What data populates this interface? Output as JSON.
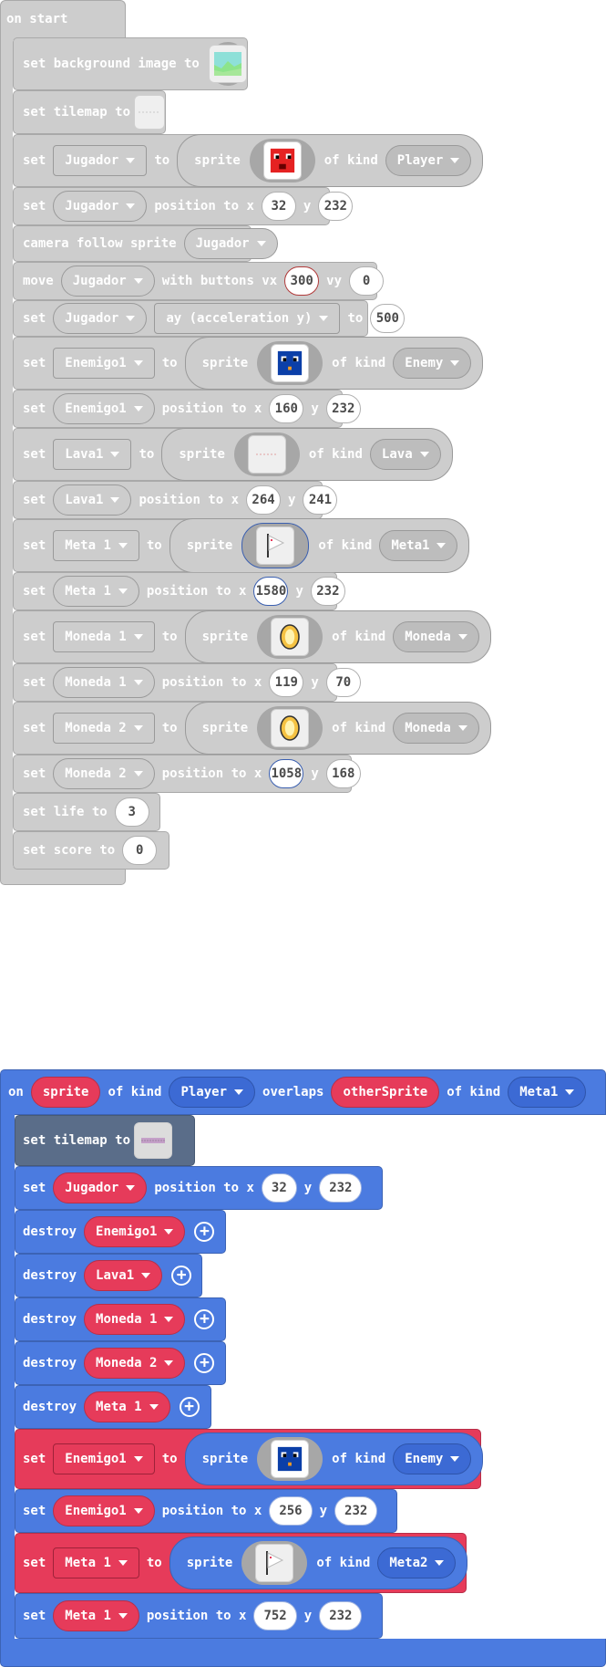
{
  "event1": {
    "label": "on start",
    "rows": {
      "bg": {
        "label": "set background image to"
      },
      "tilemap": {
        "label": "set tilemap to"
      },
      "jugador_sprite": {
        "set": "set",
        "var": "Jugador",
        "to": "to",
        "sprite": "sprite",
        "of_kind": "of kind",
        "kind": "Player"
      },
      "jugador_pos": {
        "set": "set",
        "var": "Jugador",
        "pos": "position to x",
        "x": "32",
        "y_label": "y",
        "y": "232"
      },
      "camera": {
        "label": "camera follow sprite",
        "var": "Jugador"
      },
      "move": {
        "label": "move",
        "var": "Jugador",
        "with": "with buttons vx",
        "vx": "300",
        "vy_label": "vy",
        "vy": "0"
      },
      "accel": {
        "set": "set",
        "var": "Jugador",
        "prop": "ay (acceleration y)",
        "to": "to",
        "value": "500"
      },
      "enemigo_sprite": {
        "set": "set",
        "var": "Enemigo1",
        "to": "to",
        "sprite": "sprite",
        "of_kind": "of kind",
        "kind": "Enemy"
      },
      "enemigo_pos": {
        "set": "set",
        "var": "Enemigo1",
        "pos": "position to x",
        "x": "160",
        "y_label": "y",
        "y": "232"
      },
      "lava_sprite": {
        "set": "set",
        "var": "Lava1",
        "to": "to",
        "sprite": "sprite",
        "of_kind": "of kind",
        "kind": "Lava"
      },
      "lava_pos": {
        "set": "set",
        "var": "Lava1",
        "pos": "position to x",
        "x": "264",
        "y_label": "y",
        "y": "241"
      },
      "meta_sprite": {
        "set": "set",
        "var": "Meta 1",
        "to": "to",
        "sprite": "sprite",
        "of_kind": "of kind",
        "kind": "Meta1"
      },
      "meta_pos": {
        "set": "set",
        "var": "Meta 1",
        "pos": "position to x",
        "x": "1580",
        "y_label": "y",
        "y": "232"
      },
      "moneda1_sprite": {
        "set": "set",
        "var": "Moneda 1",
        "to": "to",
        "sprite": "sprite",
        "of_kind": "of kind",
        "kind": "Moneda"
      },
      "moneda1_pos": {
        "set": "set",
        "var": "Moneda 1",
        "pos": "position to x",
        "x": "119",
        "y_label": "y",
        "y": "70"
      },
      "moneda2_sprite": {
        "set": "set",
        "var": "Moneda 2",
        "to": "to",
        "sprite": "sprite",
        "of_kind": "of kind",
        "kind": "Moneda"
      },
      "moneda2_pos": {
        "set": "set",
        "var": "Moneda 2",
        "pos": "position to x",
        "x": "1058",
        "y_label": "y",
        "y": "168"
      },
      "life": {
        "label": "set life to",
        "value": "3"
      },
      "score": {
        "label": "set score to",
        "value": "0"
      }
    }
  },
  "event2": {
    "on": "on",
    "sprite": "sprite",
    "of_kind": "of kind",
    "kind": "Player",
    "overlaps": "overlaps",
    "other": "otherSprite",
    "of_kind2": "of kind",
    "kind2": "Meta1",
    "rows": {
      "tilemap": {
        "label": "set tilemap to"
      },
      "jugador_pos": {
        "set": "set",
        "var": "Jugador",
        "pos": "position to x",
        "x": "32",
        "y_label": "y",
        "y": "232"
      },
      "d1": {
        "label": "destroy",
        "var": "Enemigo1"
      },
      "d2": {
        "label": "destroy",
        "var": "Lava1"
      },
      "d3": {
        "label": "destroy",
        "var": "Moneda 1"
      },
      "d4": {
        "label": "destroy",
        "var": "Moneda 2"
      },
      "d5": {
        "label": "destroy",
        "var": "Meta 1"
      },
      "enemigo_sprite": {
        "set": "set",
        "var": "Enemigo1",
        "to": "to",
        "sprite": "sprite",
        "of_kind": "of kind",
        "kind": "Enemy"
      },
      "enemigo_pos": {
        "set": "set",
        "var": "Enemigo1",
        "pos": "position to x",
        "x": "256",
        "y_label": "y",
        "y": "232"
      },
      "meta_sprite": {
        "set": "set",
        "var": "Meta 1",
        "to": "to",
        "sprite": "sprite",
        "of_kind": "of kind",
        "kind": "Meta2"
      },
      "meta_pos": {
        "set": "set",
        "var": "Meta 1",
        "pos": "position to x",
        "x": "752",
        "y_label": "y",
        "y": "232"
      }
    }
  },
  "colors": {
    "grey_block": "#cdcdcd",
    "blue_block": "#4b7be0",
    "red_block": "#e63b5a"
  },
  "icons": [
    "image-icon",
    "tilemap-icon",
    "player-sprite-icon",
    "enemy-sprite-icon",
    "lava-sprite-icon",
    "flag-sprite-icon",
    "coin-sprite-icon",
    "plus-icon",
    "dropdown-caret-icon"
  ]
}
